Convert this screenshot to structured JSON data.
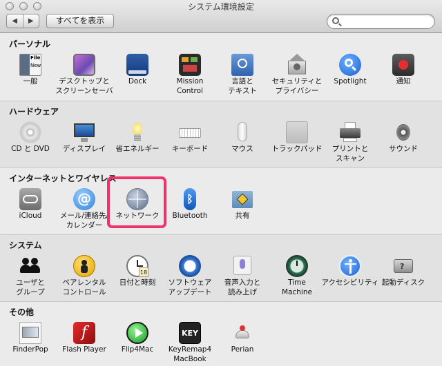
{
  "window": {
    "title": "システム環境設定",
    "show_all": "すべてを表示",
    "back_icon": "◀",
    "forward_icon": "▶",
    "search_placeholder": ""
  },
  "sections": [
    {
      "title": "パーソナル",
      "items": [
        {
          "label": "一般",
          "icon": "general-icon"
        },
        {
          "label": "デスクトップと\nスクリーンセーバ",
          "icon": "desktop-icon"
        },
        {
          "label": "Dock",
          "icon": "dock-icon"
        },
        {
          "label": "Mission\nControl",
          "icon": "mission-control-icon"
        },
        {
          "label": "言語と\nテキスト",
          "icon": "language-icon"
        },
        {
          "label": "セキュリティと\nプライバシー",
          "icon": "security-icon"
        },
        {
          "label": "Spotlight",
          "icon": "spotlight-icon"
        },
        {
          "label": "通知",
          "icon": "notifications-icon"
        }
      ]
    },
    {
      "title": "ハードウェア",
      "items": [
        {
          "label": "CD と DVD",
          "icon": "cd-icon"
        },
        {
          "label": "ディスプレイ",
          "icon": "display-icon"
        },
        {
          "label": "省エネルギー",
          "icon": "energy-icon"
        },
        {
          "label": "キーボード",
          "icon": "keyboard-icon"
        },
        {
          "label": "マウス",
          "icon": "mouse-icon"
        },
        {
          "label": "トラックパッド",
          "icon": "trackpad-icon"
        },
        {
          "label": "プリントと\nスキャン",
          "icon": "printer-icon"
        },
        {
          "label": "サウンド",
          "icon": "sound-icon"
        }
      ]
    },
    {
      "title": "インターネットとワイヤレス",
      "items": [
        {
          "label": "iCloud",
          "icon": "icloud-icon"
        },
        {
          "label": "メール/連絡先/\nカレンダー",
          "icon": "mail-icon"
        },
        {
          "label": "ネットワーク",
          "icon": "network-icon"
        },
        {
          "label": "Bluetooth",
          "icon": "bluetooth-icon"
        },
        {
          "label": "共有",
          "icon": "sharing-icon"
        }
      ]
    },
    {
      "title": "システム",
      "items": [
        {
          "label": "ユーザと\nグループ",
          "icon": "users-icon"
        },
        {
          "label": "ペアレンタル\nコントロール",
          "icon": "parental-icon"
        },
        {
          "label": "日付と時刻",
          "icon": "clock-icon"
        },
        {
          "label": "ソフトウェア\nアップデート",
          "icon": "update-icon"
        },
        {
          "label": "音声入力と\n読み上げ",
          "icon": "microphone-icon"
        },
        {
          "label": "Time\nMachine",
          "icon": "time-machine-icon"
        },
        {
          "label": "アクセシビリティ",
          "icon": "accessibility-icon"
        },
        {
          "label": "起動ディスク",
          "icon": "startup-disk-icon"
        }
      ]
    },
    {
      "title": "その他",
      "items": [
        {
          "label": "FinderPop",
          "icon": "finderpop-icon"
        },
        {
          "label": "Flash Player",
          "icon": "flash-icon"
        },
        {
          "label": "Flip4Mac",
          "icon": "flip4mac-icon"
        },
        {
          "label": "KeyRemap4\nMacBook",
          "icon": "keyremap-icon"
        },
        {
          "label": "Perian",
          "icon": "perian-icon"
        }
      ]
    }
  ],
  "icon_texts": {
    "key": "KEY",
    "file": "File",
    "new": "New",
    "calendar_day": "18"
  },
  "highlight_color": "#f0326c"
}
